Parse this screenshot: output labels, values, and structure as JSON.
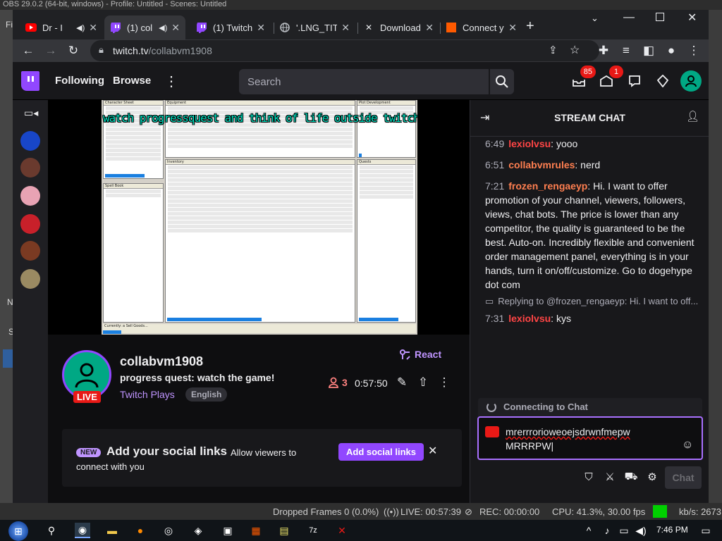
{
  "obs": {
    "title": "OBS 29.0.2 (64-bit, windows) - Profile: Untitled - Scenes: Untitled",
    "left_labels": [
      "Fi",
      "N",
      "S",
      "S"
    ],
    "status": {
      "dropped": "Dropped Frames 0 (0.0%)",
      "live": "LIVE: 00:57:39",
      "rec": "REC: 00:00:00",
      "cpu": "CPU: 41.3%, 30.00 fps",
      "kbs": "kb/s: 2673"
    }
  },
  "browser": {
    "tabs": [
      {
        "label": "Dr - I",
        "icon": "youtube-icon",
        "color": "#ff0000"
      },
      {
        "label": "(1) col",
        "icon": "twitch-icon",
        "color": "#9147ff"
      },
      {
        "label": "(1) Twitch",
        "icon": "twitch-icon",
        "color": "#9147ff"
      },
      {
        "label": "'.LNG_TITL",
        "icon": "globe-icon",
        "color": "#bdc1c6"
      },
      {
        "label": "Download",
        "icon": "x-logo-icon",
        "color": "#e8eaed"
      },
      {
        "label": "Connect y",
        "icon": "orange-square-icon",
        "color": "#ff5a00"
      }
    ],
    "new_tab": "+",
    "url_host": "twitch.tv",
    "url_path": "/collabvm1908"
  },
  "twitch": {
    "nav": {
      "following": "Following",
      "browse": "Browse",
      "search_placeholder": "Search",
      "inbox_badge": "85",
      "notif_badge": "1"
    },
    "stream_overlay": "watch progressquest and think of life outside twitch.",
    "game_ui": {
      "char_sheet": "Character Sheet",
      "equipment": "Equipment",
      "plot": "Plot Development",
      "inventory": "Inventory",
      "spell_book": "Spell Book",
      "quests": "Quests",
      "status": "Currently: a Sell Goods..."
    },
    "channel": {
      "name": "collabvm1908",
      "title": "progress quest: watch the game!",
      "category": "Twitch Plays",
      "tag": "English",
      "live": "LIVE",
      "react": "React",
      "viewers": "3",
      "uptime": "0:57:50"
    },
    "social": {
      "new": "NEW",
      "title": "Add your social links",
      "desc1": "Allow viewers to",
      "desc2": "connect with you",
      "button": "Add social links"
    },
    "chat": {
      "title": "STREAM CHAT",
      "messages": [
        {
          "time": "6:49",
          "user": "lexiolvsu",
          "color": "#ff4545",
          "text": ": yooo"
        },
        {
          "time": "6:51",
          "user": "collabvmrules",
          "color": "#ff7f50",
          "text": ": nerd"
        },
        {
          "time": "7:21",
          "user": "frozen_rengaeyp",
          "color": "#ff7f50",
          "text": ": Hi. I want to offer promotion of your channel, viewers, followers, views, chat bots. The price is lower than any competitor, the quality is guaranteed to be the best. Auto-on. Incredibly flexible and convenient order management panel, everything is in your hands, turn it on/off/customize. Go to dogehype dot com"
        },
        {
          "time": "7:31",
          "user": "lexiolvsu",
          "color": "#ff4545",
          "text": ": kys"
        }
      ],
      "reply": "Replying to @frozen_rengaeyp: Hi. I want to off...",
      "connecting": "Connecting to Chat",
      "input_line1": "mrerrrorioweoejsdrwnfmepw",
      "input_line2": "MRRRPW",
      "send": "Chat"
    }
  },
  "taskbar": {
    "time": "7:46 PM"
  }
}
